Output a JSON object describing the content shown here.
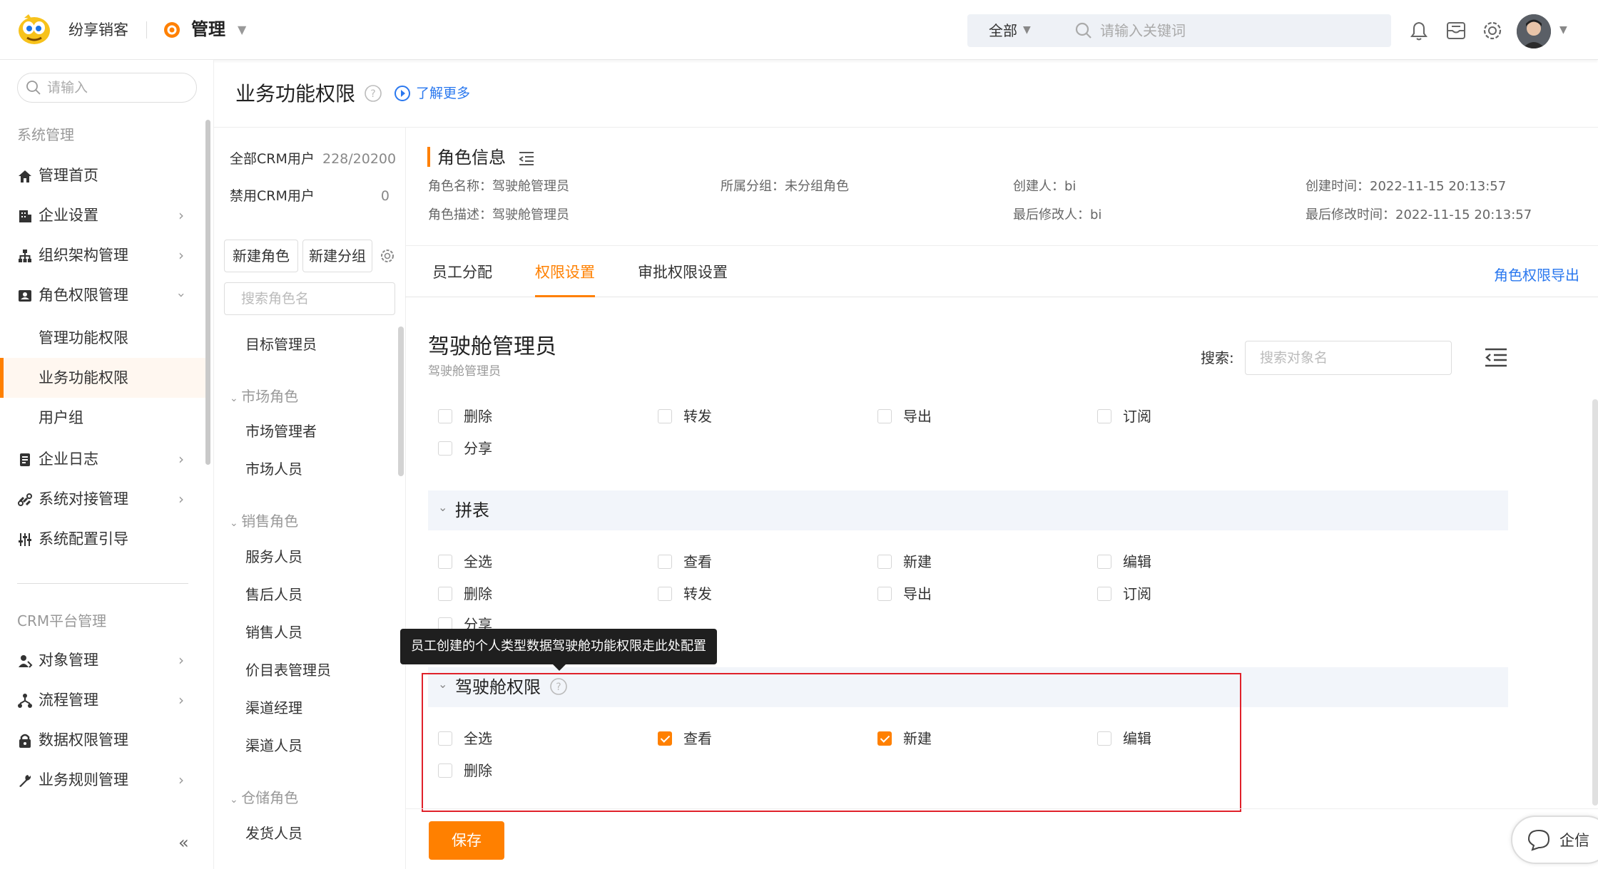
{
  "topbar": {
    "brand": "纷享销客",
    "module": "管理",
    "scope": "全部",
    "search_placeholder": "请输入关键词"
  },
  "sidebar": {
    "search_placeholder": "请输入",
    "section_system": "系统管理",
    "section_crm": "CRM平台管理",
    "items": [
      {
        "label": "管理首页",
        "icon": "home-icon"
      },
      {
        "label": "企业设置",
        "icon": "building-icon"
      },
      {
        "label": "组织架构管理",
        "icon": "org-chart-icon"
      },
      {
        "label": "角色权限管理",
        "icon": "id-card-icon"
      },
      {
        "label": "管理功能权限"
      },
      {
        "label": "业务功能权限"
      },
      {
        "label": "用户组"
      },
      {
        "label": "企业日志",
        "icon": "log-icon"
      },
      {
        "label": "系统对接管理",
        "icon": "link-icon"
      },
      {
        "label": "系统配置引导",
        "icon": "sliders-icon"
      },
      {
        "label": "对象管理",
        "icon": "user-object-icon"
      },
      {
        "label": "流程管理",
        "icon": "flow-icon"
      },
      {
        "label": "数据权限管理",
        "icon": "lock-icon"
      },
      {
        "label": "业务规则管理",
        "icon": "wrench-icon"
      }
    ],
    "collapse": "«"
  },
  "header": {
    "title": "业务功能权限",
    "learn_more": "了解更多"
  },
  "rolecol": {
    "all_users_label": "全部CRM用户",
    "all_users_value": "228/20200",
    "disabled_label": "禁用CRM用户",
    "disabled_value": "0",
    "new_role": "新建角色",
    "new_group": "新建分组",
    "search_placeholder": "搜索角色名",
    "top_role": "目标管理员",
    "groups": [
      {
        "name": "市场角色",
        "roles": [
          "市场管理者",
          "市场人员"
        ]
      },
      {
        "name": "销售角色",
        "roles": [
          "服务人员",
          "售后人员",
          "销售人员",
          "价目表管理员",
          "渠道经理",
          "渠道人员"
        ]
      },
      {
        "name": "仓储角色",
        "roles": [
          "发货人员"
        ]
      }
    ]
  },
  "info": {
    "title": "角色信息",
    "role_name": "角色名称：驾驶舱管理员",
    "role_desc": "角色描述：驾驶舱管理员",
    "group": "所属分组：未分组角色",
    "creator": "创建人：bi",
    "modifier": "最后修改人：bi",
    "created_at": "创建时间：2022-11-15 20:13:57",
    "modified_at": "最后修改时间：2022-11-15 20:13:57"
  },
  "tabs": {
    "t1": "员工分配",
    "t2": "权限设置",
    "t3": "审批权限设置",
    "export": "角色权限导出"
  },
  "object": {
    "title": "驾驶舱管理员",
    "subtitle": "驾驶舱管理员",
    "search_label": "搜索:",
    "search_placeholder": "搜索对象名"
  },
  "perms_top": [
    {
      "label": "删除",
      "checked": false
    },
    {
      "label": "转发",
      "checked": false
    },
    {
      "label": "导出",
      "checked": false
    },
    {
      "label": "订阅",
      "checked": false
    },
    {
      "label": "分享",
      "checked": false
    }
  ],
  "section_pinbiao": {
    "title": "拼表",
    "perms": [
      {
        "label": "全选",
        "checked": false
      },
      {
        "label": "查看",
        "checked": false
      },
      {
        "label": "新建",
        "checked": false
      },
      {
        "label": "编辑",
        "checked": false
      },
      {
        "label": "删除",
        "checked": false
      },
      {
        "label": "转发",
        "checked": false
      },
      {
        "label": "导出",
        "checked": false
      },
      {
        "label": "订阅",
        "checked": false
      },
      {
        "label": "分享",
        "checked": false
      }
    ]
  },
  "section_cockpit": {
    "title": "驾驶舱权限",
    "tooltip": "员工创建的个人类型数据驾驶舱功能权限走此处配置",
    "perms": [
      {
        "label": "全选",
        "checked": false
      },
      {
        "label": "查看",
        "checked": true
      },
      {
        "label": "新建",
        "checked": true
      },
      {
        "label": "编辑",
        "checked": false
      },
      {
        "label": "删除",
        "checked": false
      }
    ]
  },
  "footer": {
    "save": "保存",
    "qixin": "企信"
  },
  "colors": {
    "accent": "#ff8000",
    "link": "#2a78ef",
    "highlight_box": "#e0212a"
  }
}
